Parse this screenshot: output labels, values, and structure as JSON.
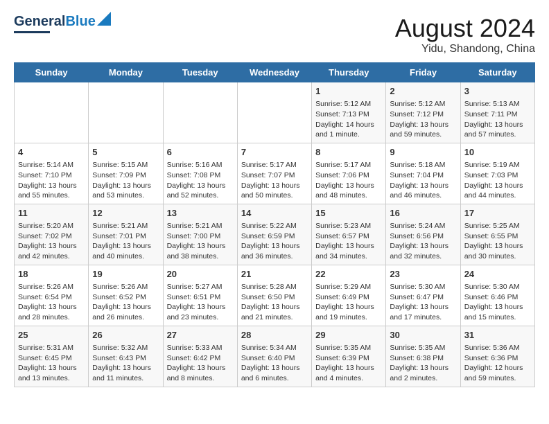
{
  "header": {
    "logo_general": "General",
    "logo_blue": "Blue",
    "title": "August 2024",
    "subtitle": "Yidu, Shandong, China"
  },
  "weekdays": [
    "Sunday",
    "Monday",
    "Tuesday",
    "Wednesday",
    "Thursday",
    "Friday",
    "Saturday"
  ],
  "weeks": [
    [
      {
        "day": "",
        "info": ""
      },
      {
        "day": "",
        "info": ""
      },
      {
        "day": "",
        "info": ""
      },
      {
        "day": "",
        "info": ""
      },
      {
        "day": "1",
        "info": "Sunrise: 5:12 AM\nSunset: 7:13 PM\nDaylight: 14 hours\nand 1 minute."
      },
      {
        "day": "2",
        "info": "Sunrise: 5:12 AM\nSunset: 7:12 PM\nDaylight: 13 hours\nand 59 minutes."
      },
      {
        "day": "3",
        "info": "Sunrise: 5:13 AM\nSunset: 7:11 PM\nDaylight: 13 hours\nand 57 minutes."
      }
    ],
    [
      {
        "day": "4",
        "info": "Sunrise: 5:14 AM\nSunset: 7:10 PM\nDaylight: 13 hours\nand 55 minutes."
      },
      {
        "day": "5",
        "info": "Sunrise: 5:15 AM\nSunset: 7:09 PM\nDaylight: 13 hours\nand 53 minutes."
      },
      {
        "day": "6",
        "info": "Sunrise: 5:16 AM\nSunset: 7:08 PM\nDaylight: 13 hours\nand 52 minutes."
      },
      {
        "day": "7",
        "info": "Sunrise: 5:17 AM\nSunset: 7:07 PM\nDaylight: 13 hours\nand 50 minutes."
      },
      {
        "day": "8",
        "info": "Sunrise: 5:17 AM\nSunset: 7:06 PM\nDaylight: 13 hours\nand 48 minutes."
      },
      {
        "day": "9",
        "info": "Sunrise: 5:18 AM\nSunset: 7:04 PM\nDaylight: 13 hours\nand 46 minutes."
      },
      {
        "day": "10",
        "info": "Sunrise: 5:19 AM\nSunset: 7:03 PM\nDaylight: 13 hours\nand 44 minutes."
      }
    ],
    [
      {
        "day": "11",
        "info": "Sunrise: 5:20 AM\nSunset: 7:02 PM\nDaylight: 13 hours\nand 42 minutes."
      },
      {
        "day": "12",
        "info": "Sunrise: 5:21 AM\nSunset: 7:01 PM\nDaylight: 13 hours\nand 40 minutes."
      },
      {
        "day": "13",
        "info": "Sunrise: 5:21 AM\nSunset: 7:00 PM\nDaylight: 13 hours\nand 38 minutes."
      },
      {
        "day": "14",
        "info": "Sunrise: 5:22 AM\nSunset: 6:59 PM\nDaylight: 13 hours\nand 36 minutes."
      },
      {
        "day": "15",
        "info": "Sunrise: 5:23 AM\nSunset: 6:57 PM\nDaylight: 13 hours\nand 34 minutes."
      },
      {
        "day": "16",
        "info": "Sunrise: 5:24 AM\nSunset: 6:56 PM\nDaylight: 13 hours\nand 32 minutes."
      },
      {
        "day": "17",
        "info": "Sunrise: 5:25 AM\nSunset: 6:55 PM\nDaylight: 13 hours\nand 30 minutes."
      }
    ],
    [
      {
        "day": "18",
        "info": "Sunrise: 5:26 AM\nSunset: 6:54 PM\nDaylight: 13 hours\nand 28 minutes."
      },
      {
        "day": "19",
        "info": "Sunrise: 5:26 AM\nSunset: 6:52 PM\nDaylight: 13 hours\nand 26 minutes."
      },
      {
        "day": "20",
        "info": "Sunrise: 5:27 AM\nSunset: 6:51 PM\nDaylight: 13 hours\nand 23 minutes."
      },
      {
        "day": "21",
        "info": "Sunrise: 5:28 AM\nSunset: 6:50 PM\nDaylight: 13 hours\nand 21 minutes."
      },
      {
        "day": "22",
        "info": "Sunrise: 5:29 AM\nSunset: 6:49 PM\nDaylight: 13 hours\nand 19 minutes."
      },
      {
        "day": "23",
        "info": "Sunrise: 5:30 AM\nSunset: 6:47 PM\nDaylight: 13 hours\nand 17 minutes."
      },
      {
        "day": "24",
        "info": "Sunrise: 5:30 AM\nSunset: 6:46 PM\nDaylight: 13 hours\nand 15 minutes."
      }
    ],
    [
      {
        "day": "25",
        "info": "Sunrise: 5:31 AM\nSunset: 6:45 PM\nDaylight: 13 hours\nand 13 minutes."
      },
      {
        "day": "26",
        "info": "Sunrise: 5:32 AM\nSunset: 6:43 PM\nDaylight: 13 hours\nand 11 minutes."
      },
      {
        "day": "27",
        "info": "Sunrise: 5:33 AM\nSunset: 6:42 PM\nDaylight: 13 hours\nand 8 minutes."
      },
      {
        "day": "28",
        "info": "Sunrise: 5:34 AM\nSunset: 6:40 PM\nDaylight: 13 hours\nand 6 minutes."
      },
      {
        "day": "29",
        "info": "Sunrise: 5:35 AM\nSunset: 6:39 PM\nDaylight: 13 hours\nand 4 minutes."
      },
      {
        "day": "30",
        "info": "Sunrise: 5:35 AM\nSunset: 6:38 PM\nDaylight: 13 hours\nand 2 minutes."
      },
      {
        "day": "31",
        "info": "Sunrise: 5:36 AM\nSunset: 6:36 PM\nDaylight: 12 hours\nand 59 minutes."
      }
    ]
  ]
}
